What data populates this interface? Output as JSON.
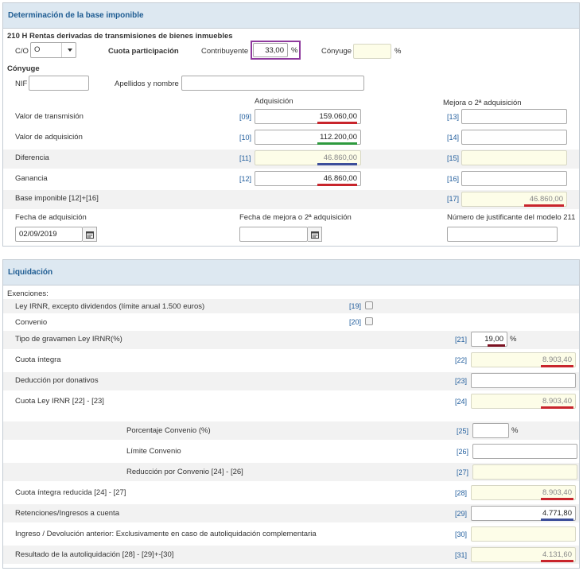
{
  "panel1": {
    "header": "Determinación de la base imponible",
    "section_title": "210 H Rentas derivadas de transmisiones de bienes inmuebles",
    "co_label": "C/O",
    "co_value": "O",
    "cuota_label": "Cuota participación",
    "contribuyente_label": "Contribuyente",
    "contribuyente_value": "33,00",
    "pct": "%",
    "conyuge_label": "Cónyuge",
    "conyuge_value": "",
    "conyuge_section": "Cónyuge",
    "nif_label": "NIF",
    "nif_value": "",
    "apellidos_label": "Apellidos y nombre",
    "apellidos_value": "",
    "col_adquisicion": "Adquisición",
    "col_mejora": "Mejora o 2ª adquisición",
    "rows": [
      {
        "label": "Valor de transmisión",
        "code1": "[09]",
        "val1": "159.060,00",
        "code2": "[13]",
        "val2": ""
      },
      {
        "label": "Valor de adquisición",
        "code1": "[10]",
        "val1": "112.200,00",
        "code2": "[14]",
        "val2": ""
      },
      {
        "label": "Diferencia",
        "code1": "[11]",
        "val1": "46.860,00",
        "code2": "[15]",
        "val2": ""
      },
      {
        "label": "Ganancia",
        "code1": "[12]",
        "val1": "46.860,00",
        "code2": "[16]",
        "val2": ""
      }
    ],
    "base_label": "Base imponible [12]+[16]",
    "base_code": "[17]",
    "base_value": "46.860,00",
    "fecha_adq_label": "Fecha de adquisición",
    "fecha_adq_value": "02/09/2019",
    "fecha_mejora_label": "Fecha de mejora o 2ª adquisición",
    "fecha_mejora_value": "",
    "justificante_label": "Número de justificante del modelo 211",
    "justificante_value": ""
  },
  "panel2": {
    "header": "Liquidación",
    "exenciones_label": "Exenciones:",
    "ley_irnr_label": "Ley IRNR, excepto dividendos (límite anual 1.500 euros)",
    "ley_irnr_code": "[19]",
    "convenio_label": "Convenio",
    "convenio_code": "[20]",
    "tipo_label": "Tipo de gravamen Ley IRNR(%)",
    "tipo_code": "[21]",
    "tipo_value": "19,00",
    "pct": "%",
    "cuota_integra_label": "Cuota íntegra",
    "cuota_integra_code": "[22]",
    "cuota_integra_value": "8.903,40",
    "deduccion_label": "Deducción por donativos",
    "deduccion_code": "[23]",
    "deduccion_value": "",
    "cuota_ley_label": "Cuota Ley IRNR [22] - [23]",
    "cuota_ley_code": "[24]",
    "cuota_ley_value": "8.903,40",
    "porc_convenio_label": "Porcentaje Convenio (%)",
    "porc_convenio_code": "[25]",
    "porc_convenio_value": "",
    "limite_label": "Límite Convenio",
    "limite_code": "[26]",
    "limite_value": "",
    "reduccion_label": "Reducción por Convenio [24] - [26]",
    "reduccion_code": "[27]",
    "reduccion_value": "",
    "cuota_reducida_label": "Cuota íntegra reducida [24] - [27]",
    "cuota_reducida_code": "[28]",
    "cuota_reducida_value": "8.903,40",
    "retenciones_label": "Retenciones/Ingresos a cuenta",
    "retenciones_code": "[29]",
    "retenciones_value": "4.771,80",
    "ingreso_label": "Ingreso / Devolución anterior: Exclusivamente en caso de autoliquidación complementaria",
    "ingreso_code": "[30]",
    "ingreso_value": "",
    "resultado_label": "Resultado de la autoliquidación [28] - [29]+-[30]",
    "resultado_code": "[31]",
    "resultado_value": "4.131,60"
  },
  "colors": {
    "header_bg": "#dde8f1",
    "header_text": "#1e5c92",
    "code_text": "#1f5c9c",
    "highlight_purple": "#8e3a9d",
    "underline_red": "#c8252c",
    "underline_green": "#2e9a3e",
    "underline_blue": "#3d4f9a",
    "underline_darkred": "#7a1020",
    "readonly_bg": "#fdfde8"
  }
}
